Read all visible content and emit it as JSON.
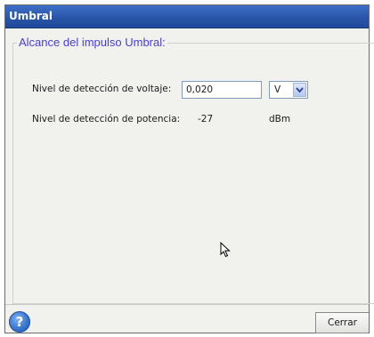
{
  "window": {
    "title": "Umbral"
  },
  "group": {
    "title": "Alcance del impulso Umbral:"
  },
  "voltage": {
    "label": "Nivel de detección de voltaje:",
    "value": "0,020",
    "unit_selected": "V"
  },
  "power": {
    "label": "Nivel de detección de potencia:",
    "value": "-27",
    "unit": "dBm"
  },
  "footer": {
    "help_icon": "help-icon",
    "help_glyph": "?",
    "close_label": "Cerrar"
  },
  "colors": {
    "titlebar": "#2a56aa",
    "group_title": "#4a3fd4",
    "background": "#f1f1ee"
  }
}
